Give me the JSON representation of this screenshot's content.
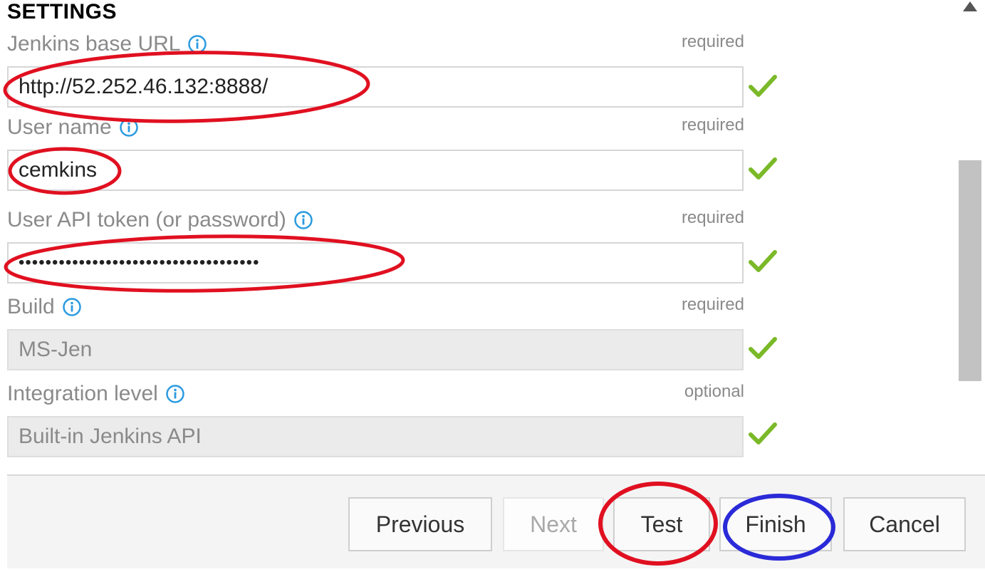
{
  "section": {
    "title": "SETTINGS"
  },
  "fields": [
    {
      "label": "Jenkins base URL",
      "status": "required",
      "value": "http://52.252.46.132:8888/",
      "disabled": false
    },
    {
      "label": "User name",
      "status": "required",
      "value": "cemkins",
      "disabled": false
    },
    {
      "label": "User API token (or password)",
      "status": "required",
      "value": "••••••••••••••••••••••••••••••••••••",
      "disabled": false
    },
    {
      "label": "Build",
      "status": "required",
      "value": "MS-Jen",
      "disabled": true
    },
    {
      "label": "Integration level",
      "status": "optional",
      "value": "Built-in Jenkins API",
      "disabled": true
    }
  ],
  "buttons": {
    "previous": "Previous",
    "next": "Next",
    "test": "Test",
    "finish": "Finish",
    "cancel": "Cancel"
  },
  "colors": {
    "check": "#7ab928",
    "info": "#2b9be0",
    "annotation_red": "#e01020",
    "annotation_blue": "#2a2ad8"
  },
  "icons": {
    "info": "info-icon",
    "check": "checkmark-icon",
    "scroll_up": "scroll-up-arrow-icon"
  }
}
